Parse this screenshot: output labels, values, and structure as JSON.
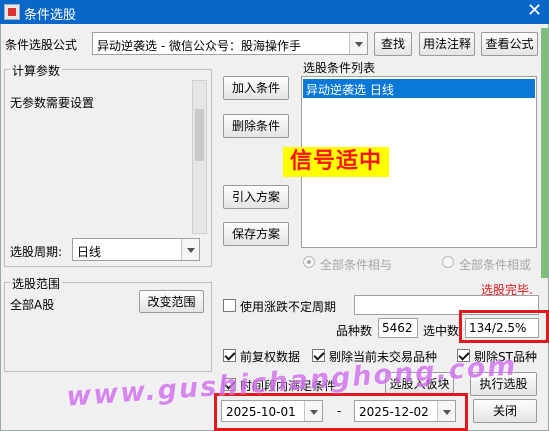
{
  "window": {
    "title": "条件选股",
    "close_glyph": "✕"
  },
  "formula": {
    "label": "条件选股公式",
    "value": "异动逆袭选  -  微信公众号：股海操作手",
    "find_button": "查找",
    "usage_button": "用法注释",
    "view_formula_button": "查看公式"
  },
  "params": {
    "legend": "计算参数",
    "empty_text": "无参数需要设置",
    "period_label": "选股周期:",
    "period_value": "日线"
  },
  "actions": {
    "add": "加入条件",
    "delete": "删除条件",
    "import": "引入方案",
    "save": "保存方案"
  },
  "conditions": {
    "label": "选股条件列表",
    "items": [
      "异动逆袭选  日线"
    ],
    "overlay_text": "信号适中",
    "radio_and": "全部条件相与",
    "radio_or": "全部条件相或"
  },
  "scope": {
    "legend": "选股范围",
    "value": "全部A股",
    "change_button": "改变范围"
  },
  "status": "选股完毕.",
  "options": {
    "volatile_period": "使用涨跌不定周期",
    "forward_adjust": "前复权数据",
    "exclude_untraded": "剔除当前未交易品种",
    "exclude_st": "剔除ST品种",
    "time_range": "时间段内满足条件"
  },
  "stats": {
    "count_label": "品种数",
    "count_value": "5462",
    "selected_label": "选中数",
    "selected_value": "134/2.5%"
  },
  "bottom": {
    "to_block_button": "选股入板块",
    "execute_button": "执行选股",
    "date_from": "2025-10-01",
    "date_separator": "-",
    "date_to": "2025-12-02",
    "close_button": "关闭"
  },
  "watermark": "www.gushichanghong.com",
  "colors": {
    "titlebar": "#0a66c9",
    "selection": "#0a78d7",
    "highlight_red": "#e0191e",
    "overlay_text": "#ff1010",
    "overlay_bg": "#ffff00",
    "status_red": "#e0191e",
    "watermark": "#d070ee"
  }
}
